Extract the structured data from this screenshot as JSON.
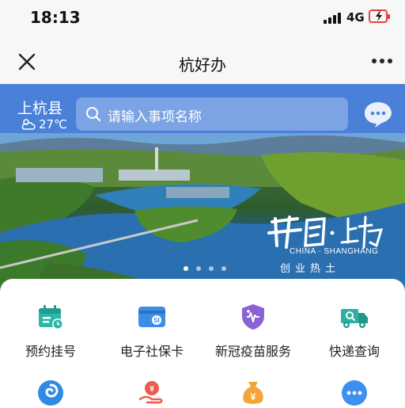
{
  "status_bar": {
    "time": "18:13",
    "network": "4G"
  },
  "nav": {
    "title": "杭好办",
    "close_icon": "close-icon",
    "more_icon": "more-dots-icon"
  },
  "banner": {
    "city": "上杭县",
    "temperature": "27℃",
    "weather_icon": "partly-cloudy-icon",
    "search_placeholder": "请输入事项名称",
    "chat_icon": "chat-bubble-icon",
    "slogan_calligraphy": "中国·上杭",
    "slogan_en": "CHINA · SHANGHANG",
    "slogan_sub": "创业热土",
    "carousel": {
      "count": 4,
      "active": 0
    }
  },
  "services": [
    {
      "label": "预约挂号",
      "icon": "calendar-clock-icon",
      "color": "#2bb8a7"
    },
    {
      "label": "电子社保卡",
      "icon": "social-security-card-icon",
      "color": "#3c8de6"
    },
    {
      "label": "新冠疫苗服务",
      "icon": "vaccine-shield-icon",
      "color": "#8a62d6"
    },
    {
      "label": "快递查询",
      "icon": "delivery-truck-icon",
      "color": "#2bb0a4"
    },
    {
      "label": "",
      "icon": "swirl-icon",
      "color": "#2f8ae5"
    },
    {
      "label": "",
      "icon": "hand-money-icon",
      "color": "#ef5b4b"
    },
    {
      "label": "",
      "icon": "money-bag-icon",
      "color": "#f2a43a"
    },
    {
      "label": "",
      "icon": "more-icon",
      "color": "#3d8ff0"
    }
  ]
}
